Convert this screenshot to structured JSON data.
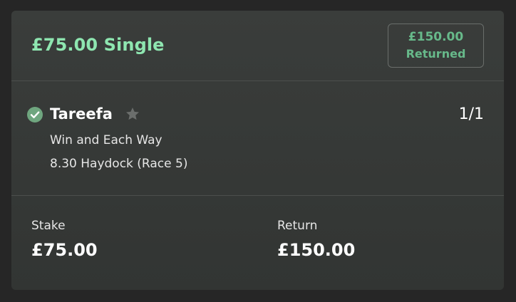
{
  "bet": {
    "title": "£75.00 Single",
    "returned_amount": "£150.00",
    "returned_label": "Returned"
  },
  "selection": {
    "name": "Tareefa",
    "odds": "1/1",
    "market": "Win and Each Way",
    "event": "8.30 Haydock (Race 5)",
    "status_icon": "check-circle-icon",
    "favourite_icon": "star-icon"
  },
  "summary": {
    "stake_label": "Stake",
    "stake_value": "£75.00",
    "return_label": "Return",
    "return_value": "£150.00"
  },
  "colors": {
    "page_background": "#262626",
    "card_background": "#363937",
    "accent_green": "#8ee6b0",
    "returned_green": "#67b98a",
    "check_green": "#6fa67f",
    "star_grey": "#6b6e6c"
  }
}
